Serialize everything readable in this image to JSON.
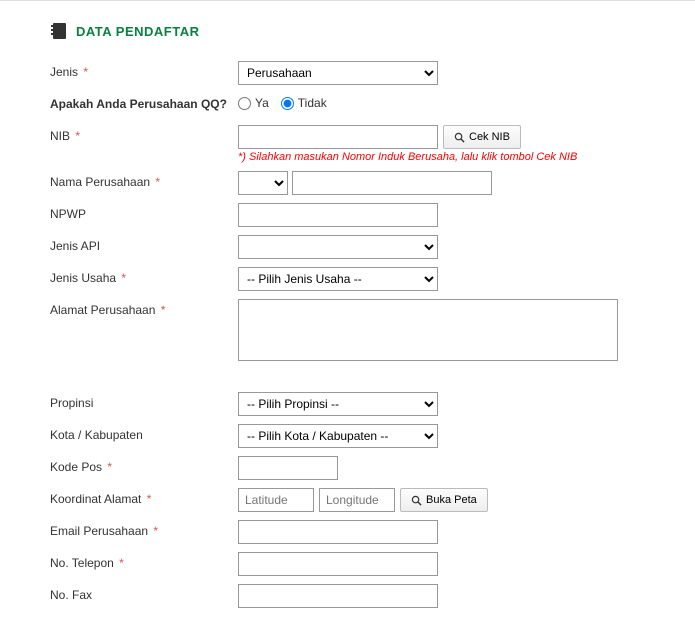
{
  "section_title": "DATA PENDAFTAR",
  "labels": {
    "jenis": "Jenis",
    "qq": "Apakah Anda Perusahaan QQ?",
    "ya": "Ya",
    "tidak": "Tidak",
    "nib": "NIB",
    "cek_nib": "Cek NIB",
    "nib_hint": "*) Silahkan masukan Nomor Induk Berusaha, lalu klik tombol Cek NIB",
    "nama_perusahaan": "Nama Perusahaan",
    "npwp": "NPWP",
    "jenis_api": "Jenis API",
    "jenis_usaha": "Jenis Usaha",
    "alamat_perusahaan": "Alamat Perusahaan",
    "propinsi": "Propinsi",
    "kota": "Kota / Kabupaten",
    "kode_pos": "Kode Pos",
    "koordinat": "Koordinat Alamat",
    "latitude_ph": "Latitude",
    "longitude_ph": "Longitude",
    "buka_peta": "Buka Peta",
    "email": "Email Perusahaan",
    "telepon": "No. Telepon",
    "fax": "No. Fax"
  },
  "options": {
    "jenis_selected": "Perusahaan",
    "jenis_usaha_ph": "-- Pilih Jenis Usaha --",
    "propinsi_ph": "-- Pilih Propinsi --",
    "kota_ph": "-- Pilih Kota / Kabupaten --"
  }
}
